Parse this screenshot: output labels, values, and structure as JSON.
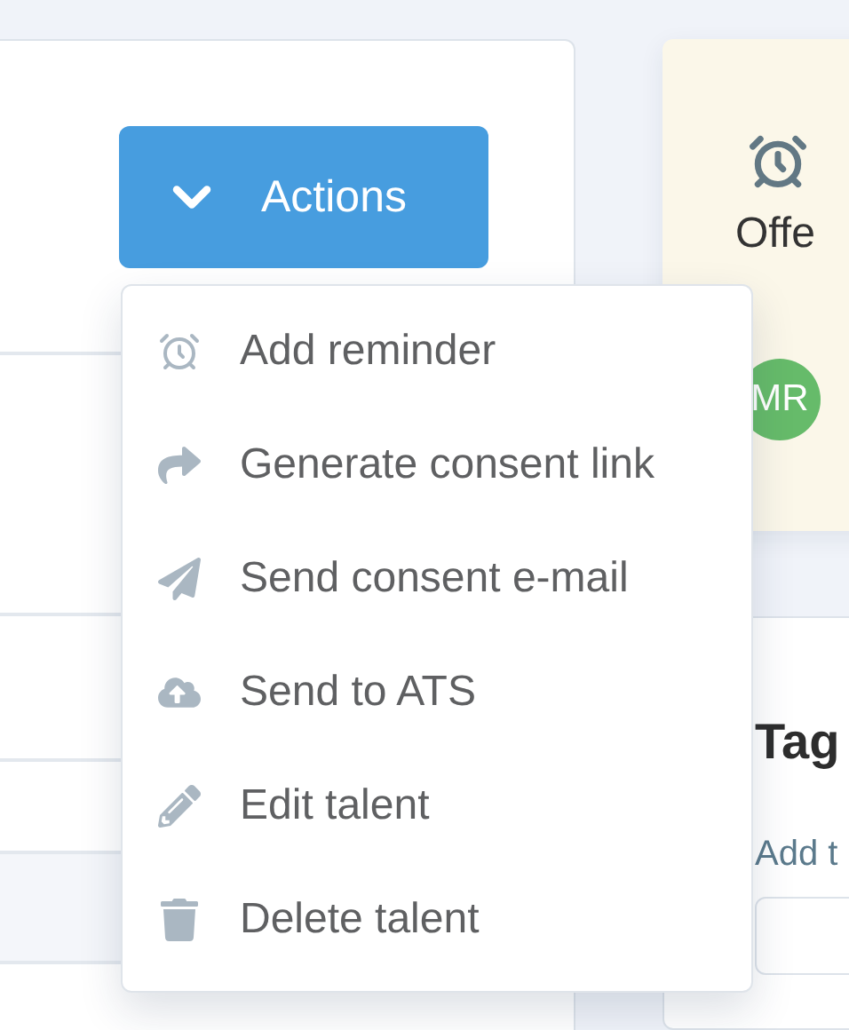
{
  "actions_button": {
    "label": "Actions"
  },
  "actions_menu": [
    {
      "kind": "alarm",
      "label": "Add reminder"
    },
    {
      "kind": "share",
      "label": "Generate consent link"
    },
    {
      "kind": "send",
      "label": "Send consent e-mail"
    },
    {
      "kind": "upload",
      "label": "Send to ATS"
    },
    {
      "kind": "edit",
      "label": "Edit talent"
    },
    {
      "kind": "delete",
      "label": "Delete talent"
    }
  ],
  "status_card": {
    "label": "Offe",
    "avatar": "MR"
  },
  "tags_card": {
    "title": "Tag",
    "link": "Add t"
  }
}
